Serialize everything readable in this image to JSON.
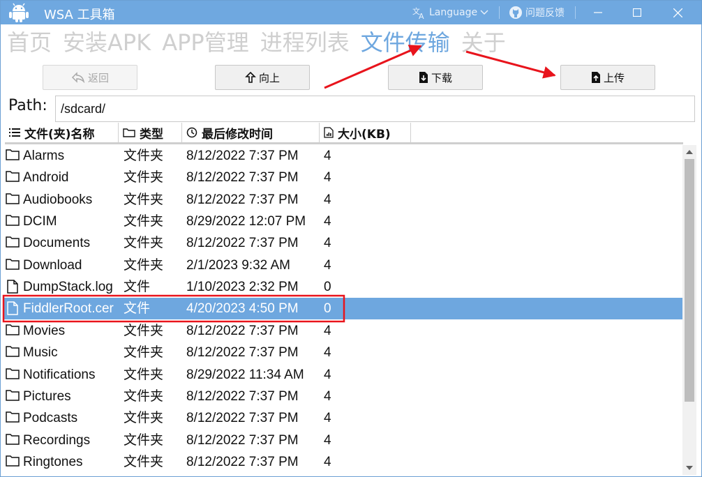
{
  "window": {
    "title": "WSA 工具箱",
    "language_label": "Language",
    "feedback_label": "问题反馈"
  },
  "nav": {
    "tabs": [
      {
        "label": "首页"
      },
      {
        "label": "安装APK"
      },
      {
        "label": "APP管理"
      },
      {
        "label": "进程列表"
      },
      {
        "label": "文件传输",
        "active": true
      },
      {
        "label": "关于"
      }
    ]
  },
  "toolbar": {
    "back_label": "返回",
    "up_label": "向上",
    "download_label": "下载",
    "upload_label": "上传"
  },
  "path": {
    "label": "Path:",
    "value": "/sdcard/"
  },
  "table": {
    "columns": [
      "文件(夹)名称",
      "类型",
      "最后修改时间",
      "大小(KB)"
    ],
    "rows": [
      {
        "name": "Alarms",
        "type": "文件夹",
        "modified": "8/12/2022 7:37 PM",
        "size": "4",
        "icon": "folder-icon"
      },
      {
        "name": "Android",
        "type": "文件夹",
        "modified": "8/12/2022 7:37 PM",
        "size": "4",
        "icon": "folder-icon"
      },
      {
        "name": "Audiobooks",
        "type": "文件夹",
        "modified": "8/12/2022 7:37 PM",
        "size": "4",
        "icon": "folder-icon"
      },
      {
        "name": "DCIM",
        "type": "文件夹",
        "modified": "8/29/2022 12:07 PM",
        "size": "4",
        "icon": "folder-icon"
      },
      {
        "name": "Documents",
        "type": "文件夹",
        "modified": "8/12/2022 7:37 PM",
        "size": "4",
        "icon": "folder-icon"
      },
      {
        "name": "Download",
        "type": "文件夹",
        "modified": "2/1/2023 9:32 AM",
        "size": "4",
        "icon": "folder-icon"
      },
      {
        "name": "DumpStack.log",
        "type": "文件",
        "modified": "1/10/2023 2:32 PM",
        "size": "0",
        "icon": "file-icon"
      },
      {
        "name": "FiddlerRoot.cer",
        "type": "文件",
        "modified": "4/20/2023 4:50 PM",
        "size": "0",
        "icon": "file-icon",
        "selected": true
      },
      {
        "name": "Movies",
        "type": "文件夹",
        "modified": "8/12/2022 7:37 PM",
        "size": "4",
        "icon": "folder-icon"
      },
      {
        "name": "Music",
        "type": "文件夹",
        "modified": "8/12/2022 7:37 PM",
        "size": "4",
        "icon": "folder-icon"
      },
      {
        "name": "Notifications",
        "type": "文件夹",
        "modified": "8/29/2022 11:34 AM",
        "size": "4",
        "icon": "folder-icon"
      },
      {
        "name": "Pictures",
        "type": "文件夹",
        "modified": "8/12/2022 7:37 PM",
        "size": "4",
        "icon": "folder-icon"
      },
      {
        "name": "Podcasts",
        "type": "文件夹",
        "modified": "8/12/2022 7:37 PM",
        "size": "4",
        "icon": "folder-icon"
      },
      {
        "name": "Recordings",
        "type": "文件夹",
        "modified": "8/12/2022 7:37 PM",
        "size": "4",
        "icon": "folder-icon"
      },
      {
        "name": "Ringtones",
        "type": "文件夹",
        "modified": "8/12/2022 7:37 PM",
        "size": "4",
        "icon": "folder-icon"
      }
    ]
  },
  "colors": {
    "titlebar": "#6fa8e0",
    "accent": "#6ea7df",
    "annotation_red": "#e8141c"
  }
}
